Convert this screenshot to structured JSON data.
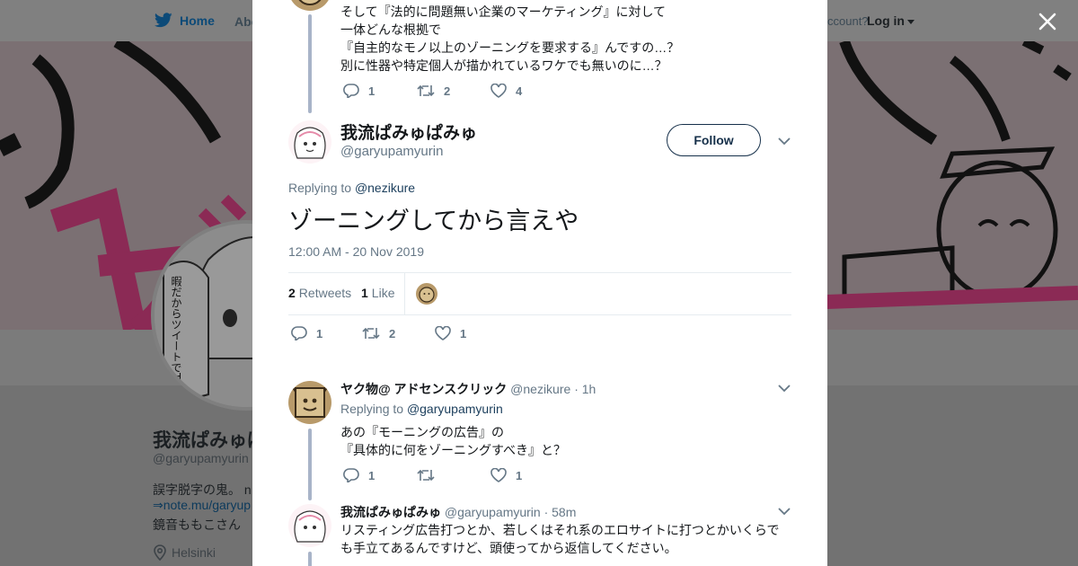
{
  "nav": {
    "home": "Home",
    "about": "Abo",
    "account_prompt": "ccount?",
    "login": "Log in"
  },
  "profile": {
    "name": "我流ぱみゅぱ",
    "handle": "@garyupamyurin",
    "bio_line1": "誤字脱字の鬼。 n",
    "bio_line2": "⇒note.mu/garyup",
    "bio_line3": "鏡音ももこさん",
    "location": "Helsinki"
  },
  "parent_tweet": {
    "lines": [
      "そして『法的に問題無い企業のマーケティング』に対して",
      "一体どんな根拠で",
      "『自主的なモノ以上のゾーニングを要求する』んですの…？",
      "別に性器や特定個人が描かれているワケでも無いのに…？"
    ],
    "replies": "1",
    "retweets": "2",
    "likes": "4"
  },
  "main_tweet": {
    "name": "我流ぱみゅぱみゅ",
    "handle": "@garyupamyurin",
    "follow_label": "Follow",
    "replying_label": "Replying to",
    "replying_to": "@nezikure",
    "text": "ゾーニングしてから言えや",
    "timestamp": "12:00 AM - 20 Nov 2019",
    "retweet_count": "2",
    "retweet_label": "Retweets",
    "like_count": "1",
    "like_label": "Like",
    "replies": "1",
    "retweets": "2",
    "likes": "1"
  },
  "reply1": {
    "name": "ヤク物@ アドセンスクリック",
    "handle": "@nezikure",
    "time": "· 1h",
    "replying_label": "Replying to",
    "replying_to": "@garyupamyurin",
    "lines": [
      "あの『モーニングの広告』の",
      "『具体的に何をゾーニングすべき』と？"
    ],
    "replies": "1",
    "retweets": "",
    "likes": "1"
  },
  "reply2": {
    "name": "我流ぱみゅぱみゅ",
    "handle": "@garyupamyurin",
    "time": "· 58m",
    "lines": [
      "リスティング広告打つとか、若しくはそれ系のエロサイトに打つとかいくらで",
      "も手立てあるんですけど、頭使ってから返信してください。"
    ]
  },
  "colors": {
    "accent": "#1da1f2",
    "link": "#1b3e5c",
    "muted": "#657786",
    "thread_line": "#a8b4c8"
  }
}
